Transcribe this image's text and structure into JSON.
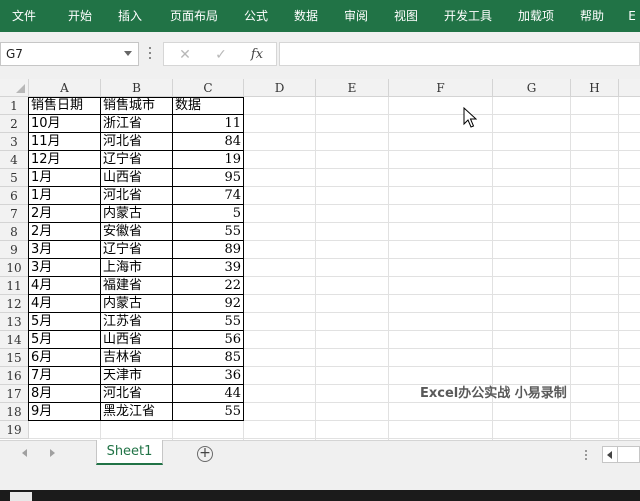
{
  "ribbon": {
    "tabs": [
      "文件",
      "开始",
      "插入",
      "页面布局",
      "公式",
      "数据",
      "审阅",
      "视图",
      "开发工具",
      "加载项",
      "帮助",
      "E"
    ]
  },
  "formula_bar": {
    "name_box": "G7",
    "cancel_icon": "✕",
    "enter_icon": "✓",
    "fx_label": "fx",
    "formula": ""
  },
  "columns": [
    "A",
    "B",
    "C",
    "D",
    "E",
    "F",
    "G",
    "H"
  ],
  "rows": [
    "1",
    "2",
    "3",
    "4",
    "5",
    "6",
    "7",
    "8",
    "9",
    "10",
    "11",
    "12",
    "13",
    "14",
    "15",
    "16",
    "17",
    "18",
    "19"
  ],
  "table": {
    "headers": [
      "销售日期",
      "销售城市",
      "数据"
    ],
    "rows": [
      [
        "10月",
        "浙江省",
        "11"
      ],
      [
        "11月",
        "河北省",
        "84"
      ],
      [
        "12月",
        "辽宁省",
        "19"
      ],
      [
        "1月",
        "山西省",
        "95"
      ],
      [
        "1月",
        "河北省",
        "74"
      ],
      [
        "2月",
        "内蒙古",
        "5"
      ],
      [
        "2月",
        "安徽省",
        "55"
      ],
      [
        "3月",
        "辽宁省",
        "89"
      ],
      [
        "3月",
        "上海市",
        "39"
      ],
      [
        "4月",
        "福建省",
        "22"
      ],
      [
        "4月",
        "内蒙古",
        "92"
      ],
      [
        "5月",
        "江苏省",
        "55"
      ],
      [
        "5月",
        "山西省",
        "56"
      ],
      [
        "6月",
        "吉林省",
        "85"
      ],
      [
        "7月",
        "天津市",
        "36"
      ],
      [
        "8月",
        "河北省",
        "44"
      ],
      [
        "9月",
        "黑龙江省",
        "55"
      ]
    ]
  },
  "watermark": "Excel办公实战 小易录制",
  "sheets": {
    "tabs": [
      "Sheet1"
    ],
    "add_icon": "+"
  },
  "colors": {
    "ribbon": "#217346",
    "sheet_tab_text": "#217346"
  }
}
